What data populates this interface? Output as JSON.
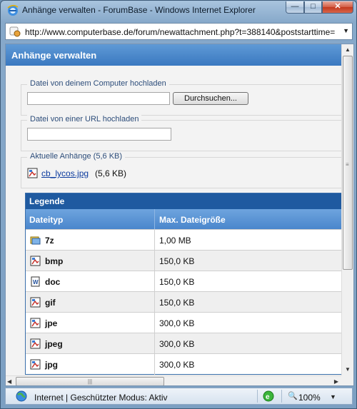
{
  "window": {
    "title": "Anhänge verwalten - ForumBase - Windows Internet Explorer",
    "controls": {
      "minimize": "—",
      "maximize": "□",
      "close": "✕"
    }
  },
  "address_bar": {
    "url": "http://www.computerbase.de/forum/newattachment.php?t=388140&poststarttime="
  },
  "page": {
    "header": "Anhänge verwalten",
    "upload_computer": {
      "legend": "Datei von deinem Computer hochladen",
      "browse_label": "Durchsuchen..."
    },
    "upload_url": {
      "legend": "Datei von einer URL hochladen"
    },
    "current": {
      "legend": "Aktuelle Anhänge (5,6 KB)",
      "file_name": "cb_lycos.jpg",
      "file_size": "(5,6 KB)"
    },
    "legend_table": {
      "title": "Legende",
      "col_type": "Dateityp",
      "col_size": "Max. Dateigröße",
      "rows": [
        {
          "ext": "7z",
          "size": "1,00 MB",
          "icon": "archive-icon"
        },
        {
          "ext": "bmp",
          "size": "150,0 KB",
          "icon": "image-icon"
        },
        {
          "ext": "doc",
          "size": "150,0 KB",
          "icon": "word-document-icon"
        },
        {
          "ext": "gif",
          "size": "150,0 KB",
          "icon": "image-icon"
        },
        {
          "ext": "jpe",
          "size": "300,0 KB",
          "icon": "image-icon"
        },
        {
          "ext": "jpeg",
          "size": "300,0 KB",
          "icon": "image-icon"
        },
        {
          "ext": "jpg",
          "size": "300,0 KB",
          "icon": "image-icon"
        }
      ]
    }
  },
  "status_bar": {
    "zone": "Internet | Geschützter Modus: Aktiv",
    "zoom": "100%"
  },
  "colors": {
    "header_blue": "#3a78c0",
    "legend_blue": "#1f5aa0",
    "link": "#0b3a9e"
  }
}
